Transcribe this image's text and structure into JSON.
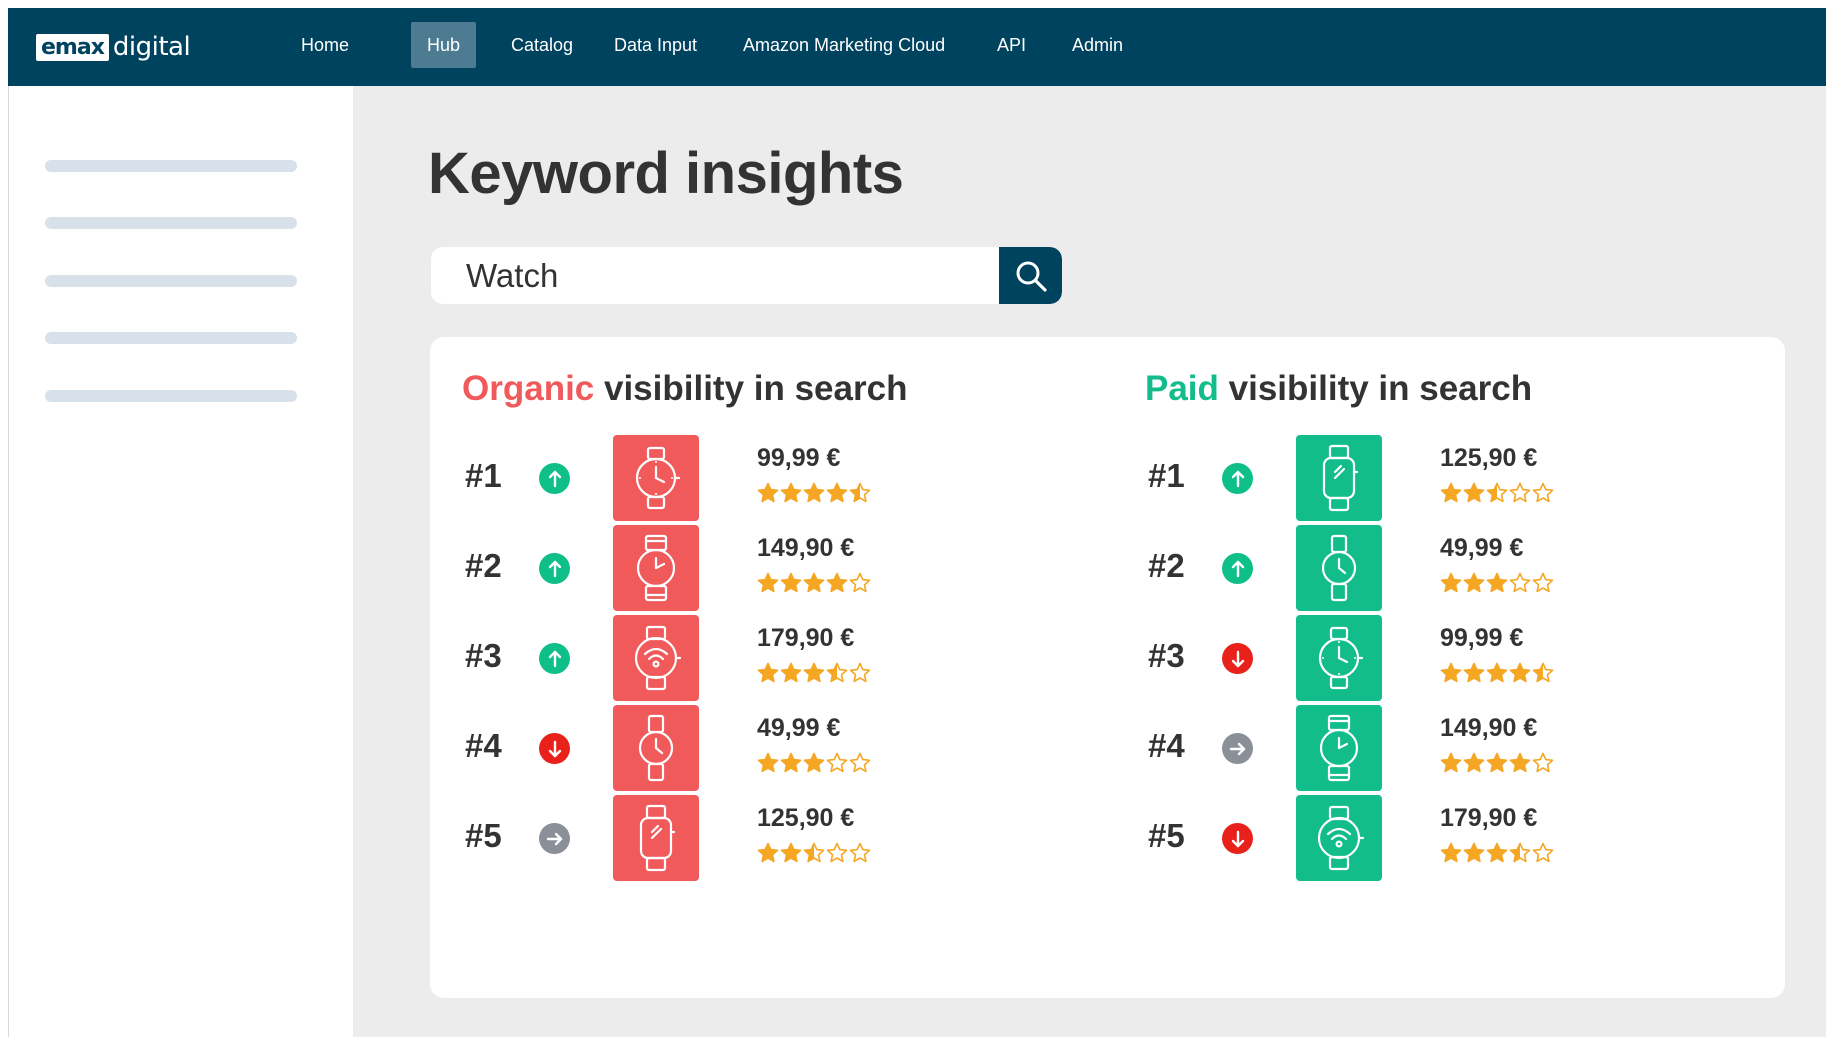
{
  "brand": {
    "logo_box": "emax",
    "logo_text": "digital"
  },
  "nav": {
    "items": [
      "Home",
      "Hub",
      "Catalog",
      "Data Input",
      "Amazon Marketing Cloud",
      "API",
      "Admin"
    ],
    "active": "Hub"
  },
  "page": {
    "title": "Keyword insights"
  },
  "search": {
    "value": "Watch"
  },
  "organic": {
    "highlight": "Organic",
    "rest": " visibility in search",
    "accent": "#f05a5b",
    "items": [
      {
        "rank": "#1",
        "trend": "up",
        "price": "99,99 €",
        "rating": 4.5,
        "watch": "analog-crown"
      },
      {
        "rank": "#2",
        "trend": "up",
        "price": "149,90 €",
        "rating": 4,
        "watch": "round-strap"
      },
      {
        "rank": "#3",
        "trend": "up",
        "price": "179,90 €",
        "rating": 3.5,
        "watch": "smart-round"
      },
      {
        "rank": "#4",
        "trend": "down",
        "price": "49,99 €",
        "rating": 3,
        "watch": "slim-round"
      },
      {
        "rank": "#5",
        "trend": "flat",
        "price": "125,90 €",
        "rating": 2.5,
        "watch": "square-smart"
      }
    ]
  },
  "paid": {
    "highlight": "Paid",
    "rest": " visibility in search",
    "accent": "#12bd8b",
    "items": [
      {
        "rank": "#1",
        "trend": "up",
        "price": "125,90 €",
        "rating": 2.5,
        "watch": "square-smart"
      },
      {
        "rank": "#2",
        "trend": "up",
        "price": "49,99 €",
        "rating": 3,
        "watch": "slim-round"
      },
      {
        "rank": "#3",
        "trend": "down",
        "price": "99,99 €",
        "rating": 4.5,
        "watch": "analog-crown"
      },
      {
        "rank": "#4",
        "trend": "flat",
        "price": "149,90 €",
        "rating": 4,
        "watch": "round-strap"
      },
      {
        "rank": "#5",
        "trend": "down",
        "price": "179,90 €",
        "rating": 3.5,
        "watch": "smart-round"
      }
    ]
  },
  "colors": {
    "navbar": "#00435f",
    "star": "#f5a623",
    "up": "#0fbf88",
    "down": "#e8221b",
    "flat": "#8a8f98"
  }
}
